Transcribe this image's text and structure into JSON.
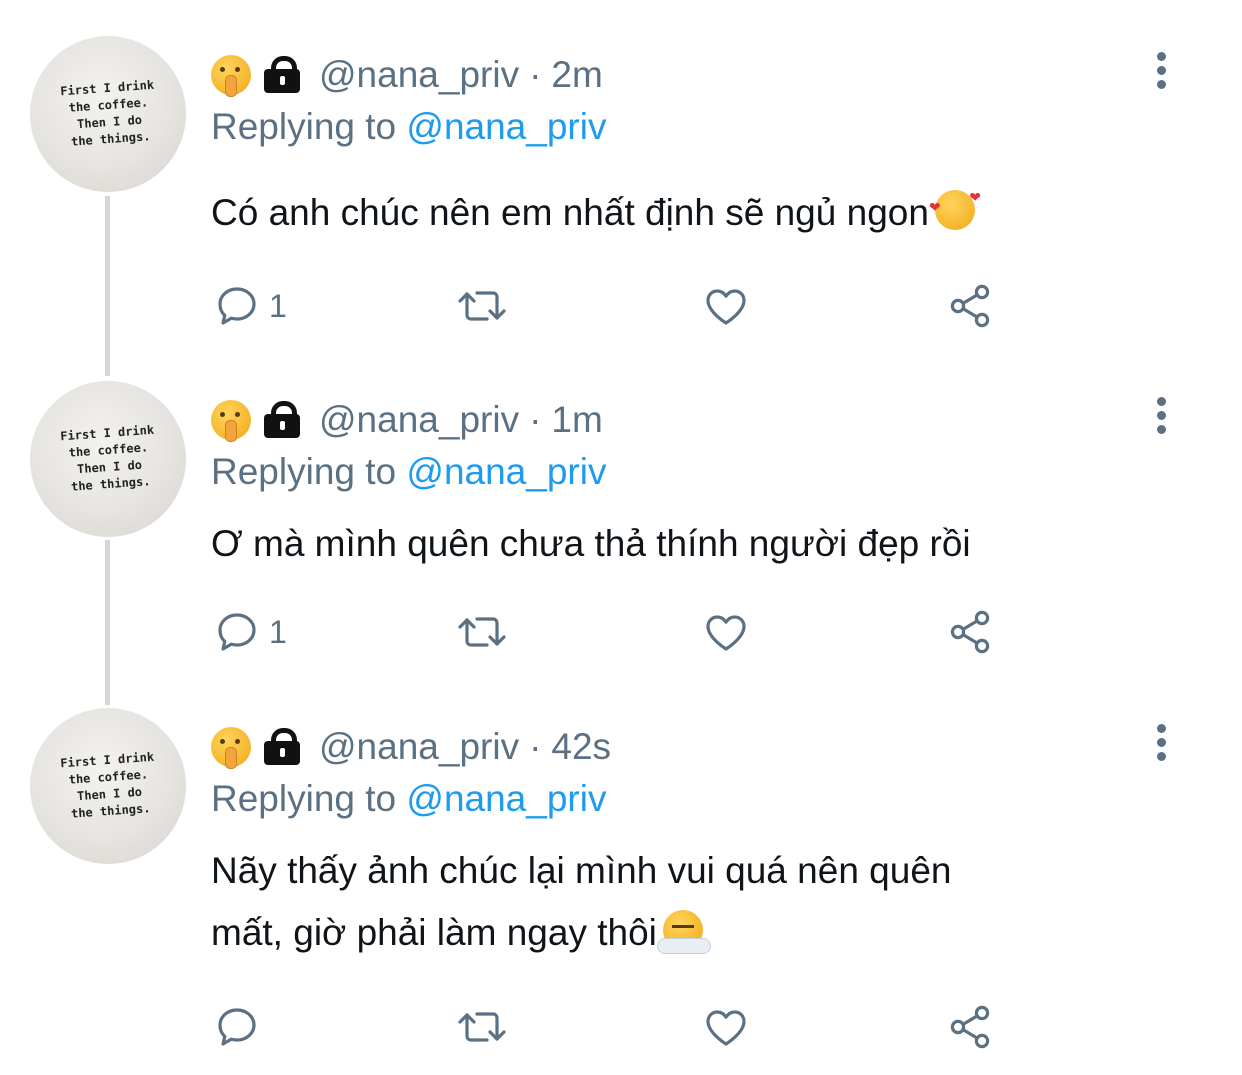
{
  "avatar_text": "First I drink\nthe coffee.\nThen I do\nthe things.",
  "colors": {
    "secondary_text": "#5b7083",
    "mention": "#1d9bf0",
    "primary_text": "#0f1419",
    "thread_line": "#d3d7dc"
  },
  "tweets": [
    {
      "handle": "@nana_priv",
      "separator": "·",
      "time": "2m",
      "replying_prefix": "Replying to",
      "replying_handle": "@nana_priv",
      "text": "Có anh chúc nên em nhất định sẽ ngủ ngon",
      "emoji": "smiling-face-with-hearts",
      "reply_count": "1"
    },
    {
      "handle": "@nana_priv",
      "separator": "·",
      "time": "1m",
      "replying_prefix": "Replying to",
      "replying_handle": "@nana_priv",
      "text": "Ơ mà mình quên chưa thả thính người đẹp rồi",
      "reply_count": "1"
    },
    {
      "handle": "@nana_priv",
      "separator": "·",
      "time": "42s",
      "replying_prefix": "Replying to",
      "replying_handle": "@nana_priv",
      "text_line1": "Nãy thấy ảnh chúc lại mình vui quá nên quên",
      "text_line2": "mất, giờ phải làm ngay thôi",
      "emoji": "face-with-steam-from-nose",
      "reply_count": ""
    }
  ],
  "icons": {
    "header": [
      "shushing-face-icon",
      "lock-icon"
    ],
    "actions": [
      "reply-icon",
      "retweet-icon",
      "like-icon",
      "share-icon"
    ],
    "menu": "more-options-icon"
  }
}
